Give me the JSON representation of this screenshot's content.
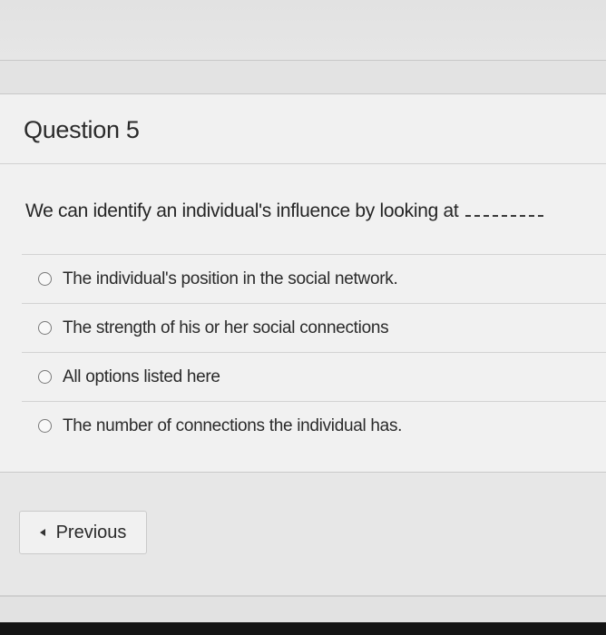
{
  "question": {
    "title": "Question 5",
    "prompt": "We can identify an individual's influence by looking at",
    "blank": "________."
  },
  "options": [
    {
      "label": "The individual's position in the social network."
    },
    {
      "label": "The strength of his or her social connections"
    },
    {
      "label": "All options listed here"
    },
    {
      "label": "The number of connections the individual has."
    }
  ],
  "navigation": {
    "previous_label": "Previous",
    "previous_icon": "caret-left-icon"
  }
}
